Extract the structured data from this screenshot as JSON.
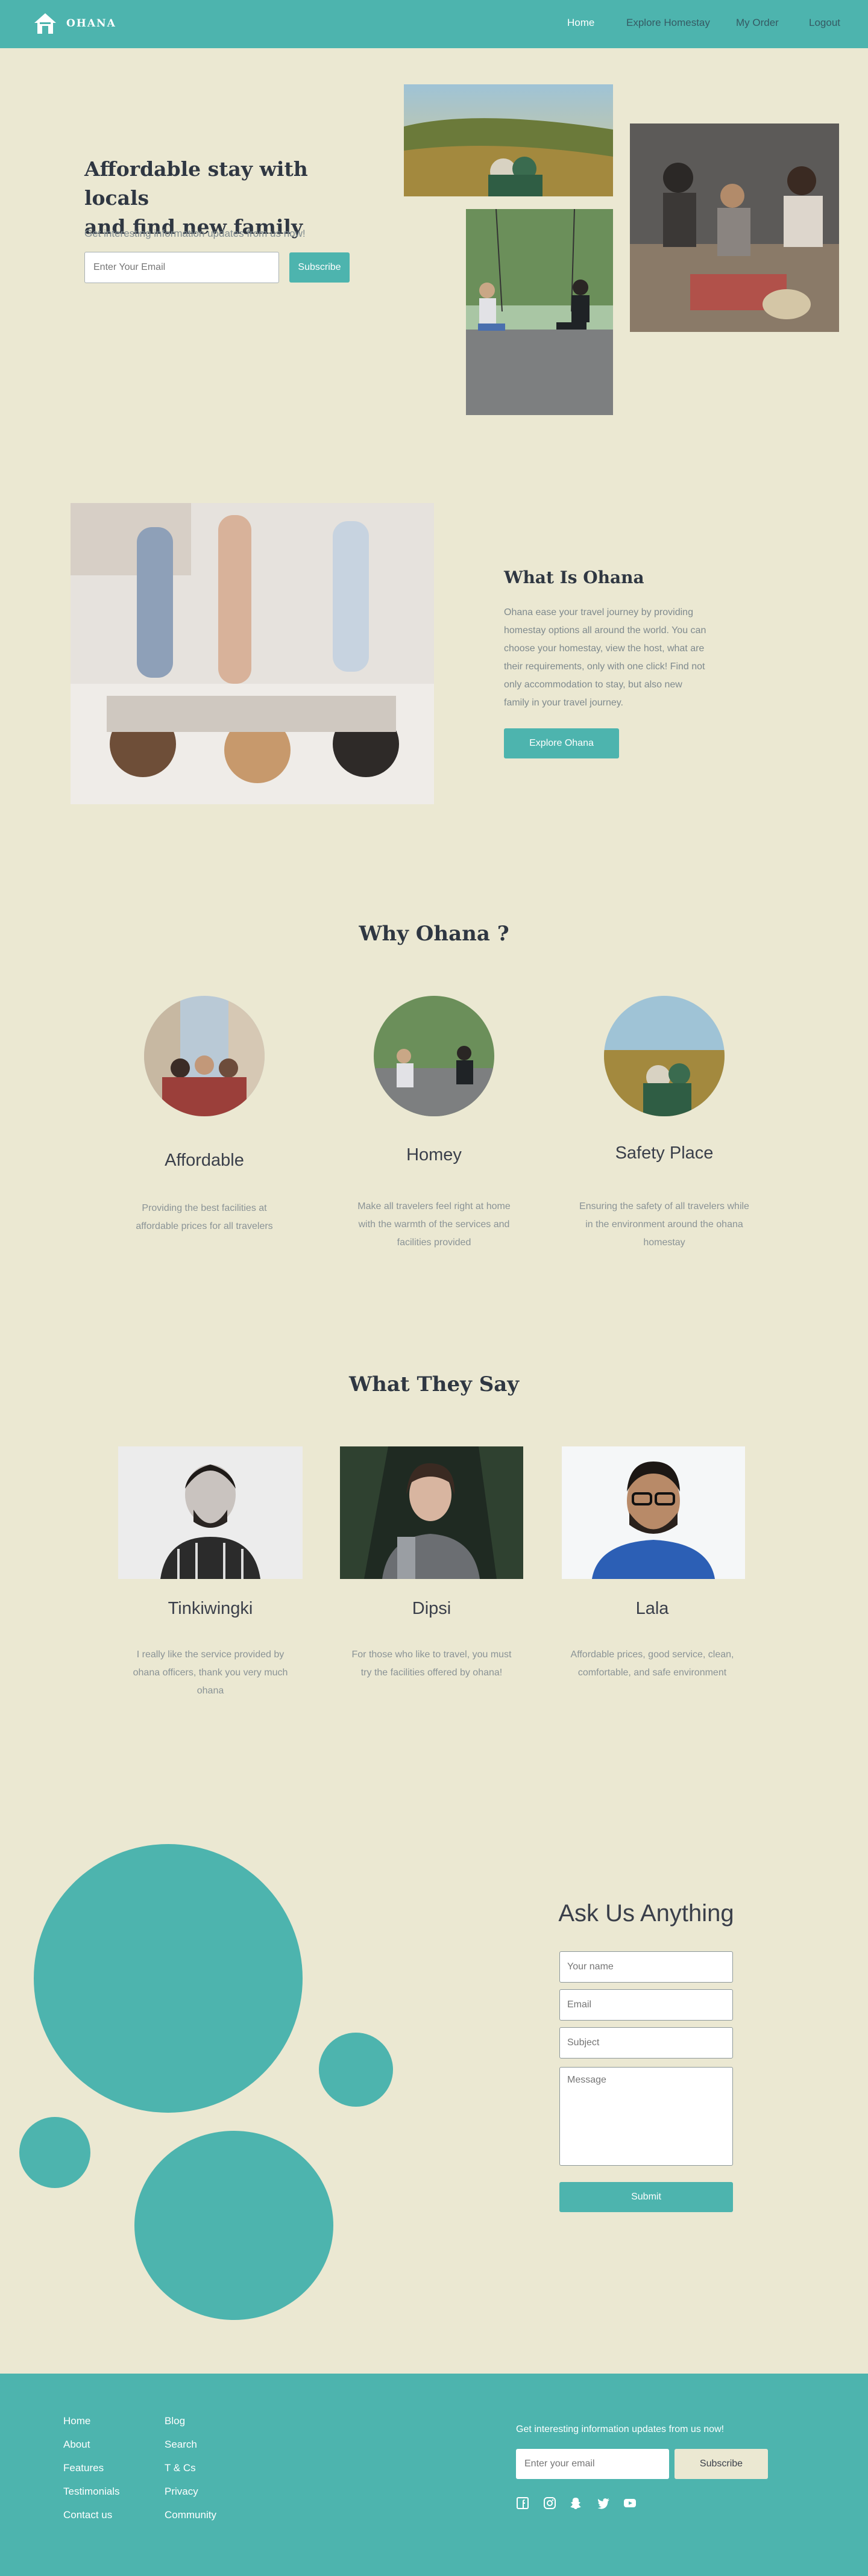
{
  "header": {
    "logo_text": "OHANA",
    "logo_icon": "house-icon",
    "nav": [
      "Home",
      "Explore Homestay",
      "My Order",
      "Logout"
    ]
  },
  "hero": {
    "title_line1": "Affordable stay with locals",
    "title_line2": "and find new family",
    "subtitle": "Get interesting information updates from us now!",
    "email_placeholder": "Enter Your Email",
    "subscribe_label": "Subscribe"
  },
  "about": {
    "title": "What Is Ohana",
    "lines": [
      "Ohana ease your travel journey by providing",
      "homestay options all around the world. You can",
      "choose your homestay, view the host, what are",
      "their requirements, only with one click! Find not",
      "only accommodation to stay, but also new",
      "family in your travel journey."
    ],
    "button_label": "Explore Ohana"
  },
  "why": {
    "title": "Why Ohana ?",
    "features": [
      {
        "title": "Affordable",
        "lines": [
          "Providing the best facilities at",
          "affordable prices for all travelers"
        ]
      },
      {
        "title": "Homey",
        "lines": [
          "Make all travelers feel right at home",
          "with the warmth of the services and",
          "facilities provided"
        ]
      },
      {
        "title": "Safety Place",
        "lines": [
          "Ensuring the safety of all travelers while",
          "in the environment around the ohana",
          "homestay"
        ]
      }
    ]
  },
  "testimonials": {
    "title": "What They Say",
    "items": [
      {
        "name": "Tinkiwingki",
        "lines": [
          "I really like the service provided by",
          "ohana officers, thank you very much",
          "ohana"
        ]
      },
      {
        "name": "Dipsi",
        "lines": [
          "For those who like to travel, you must",
          "try the facilities offered by ohana!"
        ]
      },
      {
        "name": "Lala",
        "lines": [
          "Affordable prices, good service, clean,",
          "comfortable, and safe environment"
        ]
      }
    ]
  },
  "contact": {
    "title": "Ask Us Anything",
    "name_placeholder": "Your name",
    "email_placeholder": "Email",
    "subject_placeholder": "Subject",
    "message_placeholder": "Message",
    "submit_label": "Submit"
  },
  "footer": {
    "col1": [
      "Home",
      "About",
      "Features",
      "Testimonials",
      "Contact us"
    ],
    "col2": [
      "Blog",
      "Search",
      "T & Cs",
      "Privacy",
      "Community"
    ],
    "newsletter_text": "Get interesting information updates from us now!",
    "email_placeholder": "Enter your email",
    "subscribe_label": "Subscribe",
    "social_icons": [
      "facebook-icon",
      "instagram-icon",
      "snapchat-icon",
      "twitter-icon",
      "youtube-icon"
    ]
  },
  "colors": {
    "background": "#ebe8d2",
    "accent": "#4db4ae",
    "heading": "#2f3742",
    "muted_text": "#7f8a8e"
  }
}
